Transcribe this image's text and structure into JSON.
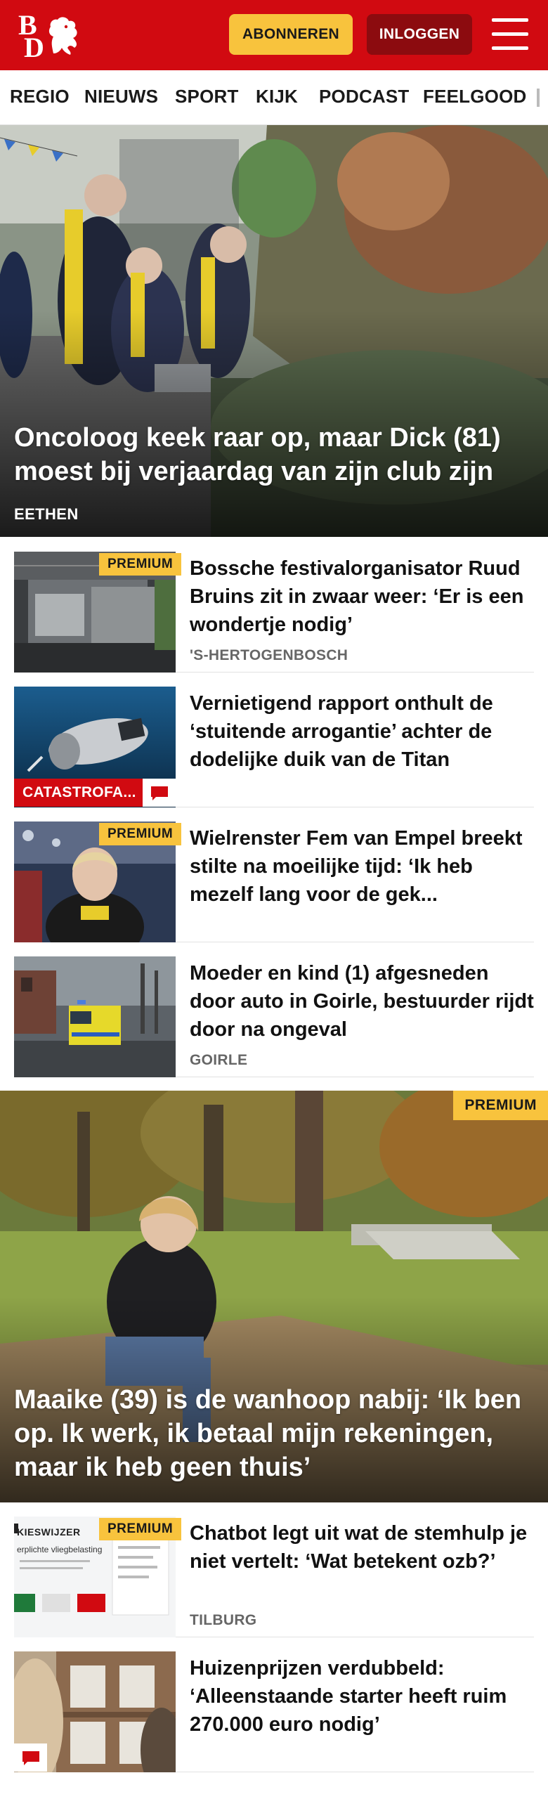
{
  "header": {
    "logo_letters": [
      "B",
      "D"
    ],
    "subscribe_label": "ABONNEREN",
    "login_label": "INLOGGEN",
    "colors": {
      "brand": "#d10a11",
      "subscribe": "#f8c33d",
      "login": "#8c0b0f"
    }
  },
  "nav": {
    "items": [
      "REGIO",
      "NIEUWS",
      "SPORT",
      "KIJK",
      "PODCAST",
      "FEELGOOD"
    ]
  },
  "hero": {
    "title": "Oncoloog keek raar op, maar Dick (81) moest bij verjaardag van zijn club zijn",
    "label": "EETHEN"
  },
  "articles": [
    {
      "title": "Bossche festivalorganisator Ruud Bruins zit in zwaar weer: ‘Er is een wondertje nodig’",
      "label": "'S-HERTOGENBOSCH",
      "badge": "PREMIUM"
    },
    {
      "title": "Vernietigend rapport onthult de ‘stuitende arrogantie’ achter de dodelijke duik van de Titan",
      "category": "CATASTROFA..."
    },
    {
      "title": "Wielrenster Fem van Empel breekt stilte na moeilijke tijd: ‘Ik heb mezelf lang voor de gek...",
      "badge": "PREMIUM"
    },
    {
      "title": "Moeder en kind (1) afgesneden door auto in Goirle, bestuurder rijdt door na ongeval",
      "label": "GOIRLE"
    }
  ],
  "feature": {
    "title": "Maaike (39) is de wanhoop nabij: ‘Ik ben op. Ik werk, ik betaal mijn rekeningen, maar ik heb geen thuis’",
    "badge": "PREMIUM"
  },
  "articles2": [
    {
      "title": "Chatbot legt uit wat de stemhulp je niet vertelt: ‘Wat betekent ozb?’",
      "label": "TILBURG",
      "badge": "PREMIUM",
      "thumb_text": "KIESWIJZER",
      "thumb_sub": "erplichte vliegbelasting"
    },
    {
      "title": "Huizenprijzen verdubbeld: ‘Alleenstaande starter heeft ruim 270.000 euro nodig’"
    }
  ]
}
